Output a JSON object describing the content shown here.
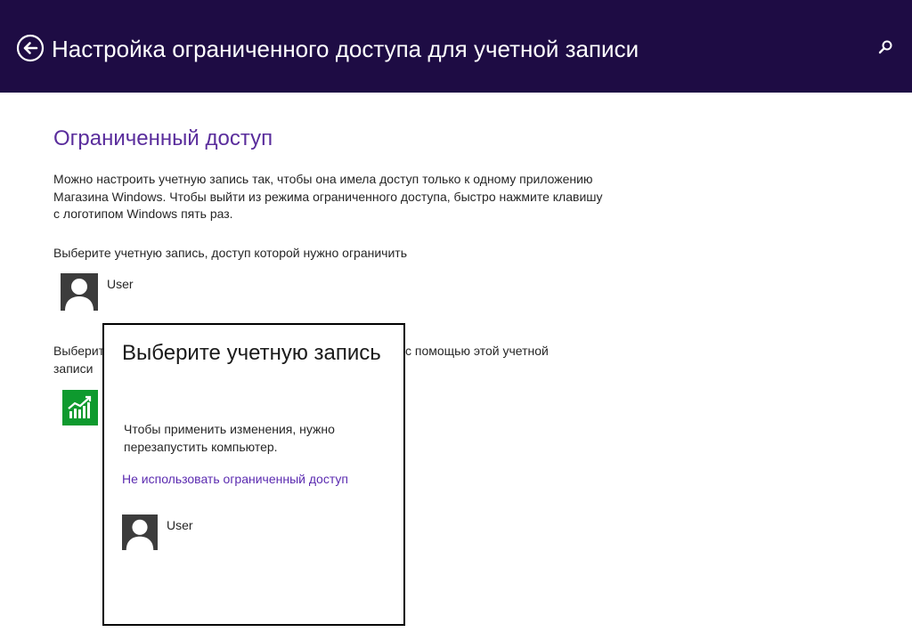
{
  "header": {
    "title": "Настройка ограниченного доступа для учетной записи",
    "back_icon": "back-arrow-icon",
    "search_icon": "search-icon"
  },
  "main": {
    "section_title": "Ограниченный доступ",
    "description": "Можно настроить учетную запись так, чтобы она имела доступ только к одному приложению Магазина Windows. Чтобы выйти из режима ограниченного доступа, быстро нажмите клавишу с логотипом Windows пять раз.",
    "choose_account_label": "Выберите учетную запись, доступ которой нужно ограничить",
    "account": {
      "name": "User",
      "icon": "user-avatar-icon"
    },
    "choose_app_label_left": "Выберите",
    "choose_app_label_left_2": "записи",
    "choose_app_label_right": "с помощью этой учетной",
    "app_icon": "finance-app-icon"
  },
  "flyout": {
    "title": "Выберите учетную запись",
    "message": "Чтобы применить изменения, нужно перезапустить компьютер.",
    "disable_link": "Не использовать ограниченный доступ",
    "account": {
      "name": "User",
      "icon": "user-avatar-icon"
    }
  },
  "colors": {
    "header_bg": "#1e0c44",
    "accent": "#5a2d9c",
    "link": "#5b2bb0",
    "app_tile": "#0e9a2e"
  }
}
